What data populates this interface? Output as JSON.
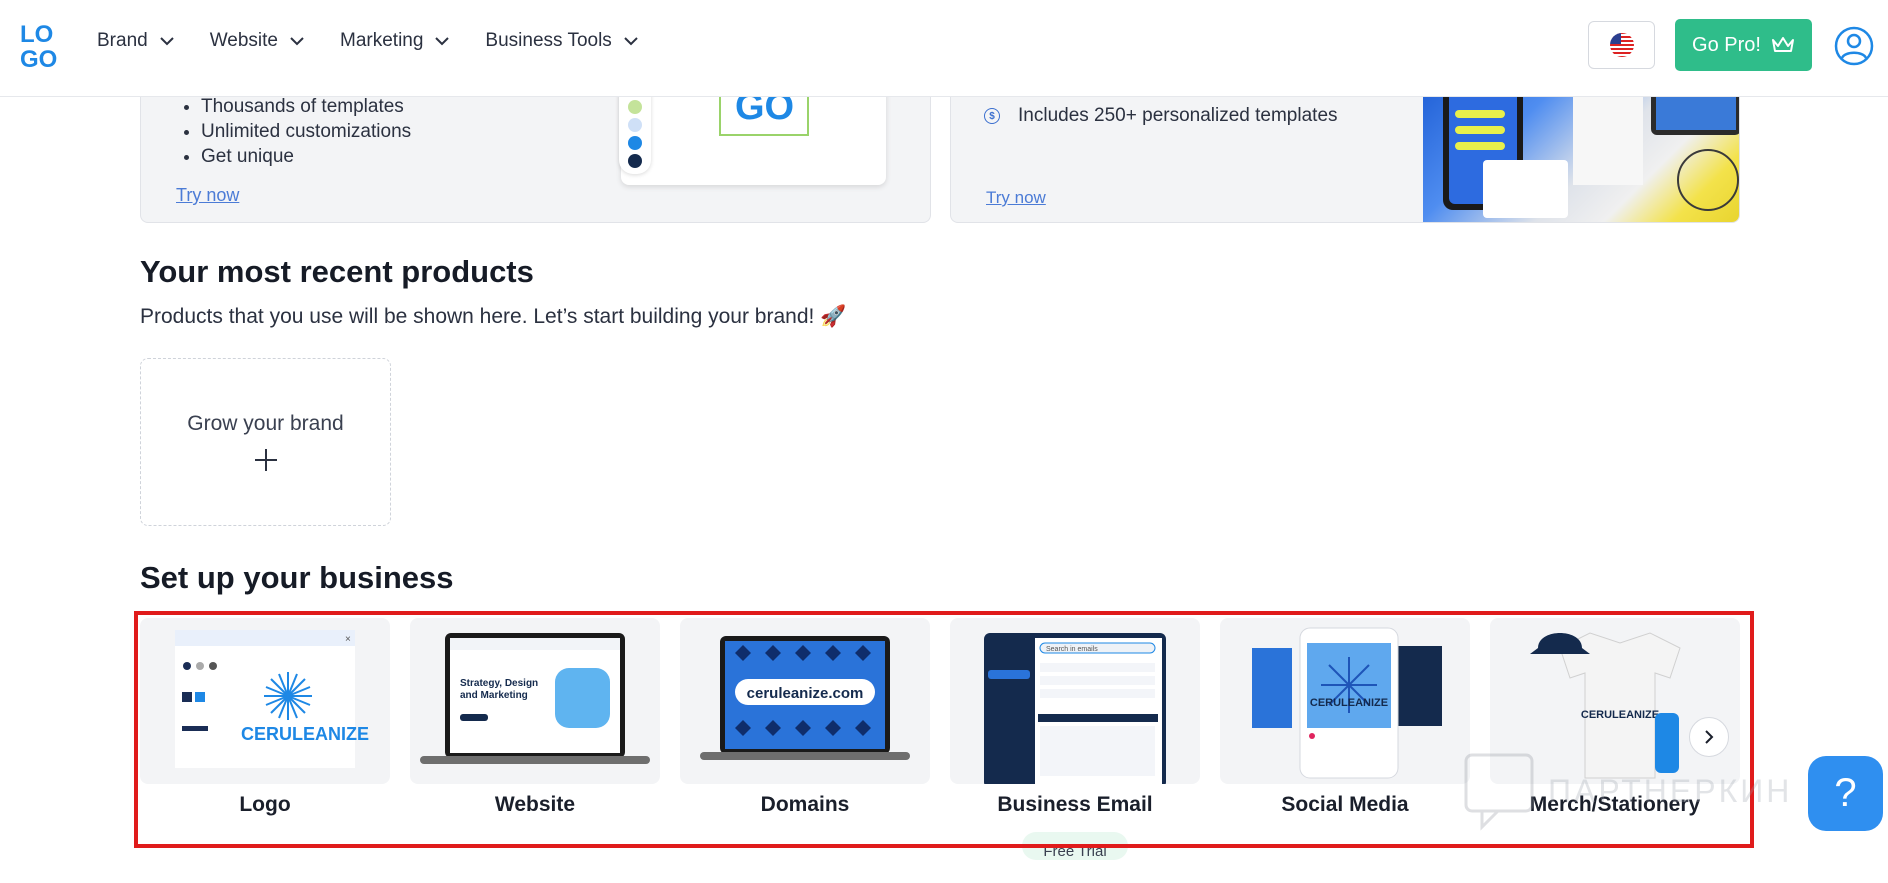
{
  "header": {
    "logo_text": "LOGO",
    "nav": [
      {
        "label": "Brand"
      },
      {
        "label": "Website"
      },
      {
        "label": "Marketing"
      },
      {
        "label": "Business Tools"
      }
    ],
    "language_flag_icon": "us-flag-icon",
    "go_pro_label": "Go Pro!",
    "go_pro_icon": "crown-icon",
    "account_icon": "user-circle-icon",
    "accent_color": "#2fbd8a"
  },
  "promo_left": {
    "bullets": [
      "Thousands of templates",
      "Unlimited customizations",
      "Get unique"
    ],
    "link": "Try now"
  },
  "promo_right": {
    "feature": "Includes 250+ personalized templates",
    "link": "Try now"
  },
  "recent": {
    "title": "Your most recent products",
    "subtitle": "Products that you use will be shown here. Let’s start building your brand! 🚀",
    "grow_label": "Grow your brand"
  },
  "setup": {
    "title": "Set up your business",
    "cards": [
      {
        "label": "Logo"
      },
      {
        "label": "Website"
      },
      {
        "label": "Domains",
        "image_text": "ceruleanize.com"
      },
      {
        "label": "Business Email"
      },
      {
        "label": "Social Media"
      },
      {
        "label": "Merch/Stationery"
      }
    ],
    "brand_name": "CERULEANIZE",
    "website_mock_heading": "Strategy, Design and Marketing",
    "email_mock_search": "Search in emails",
    "badge": "Free Trial"
  },
  "watermark": "ПАРТНЕРКИН",
  "help_label": "?"
}
